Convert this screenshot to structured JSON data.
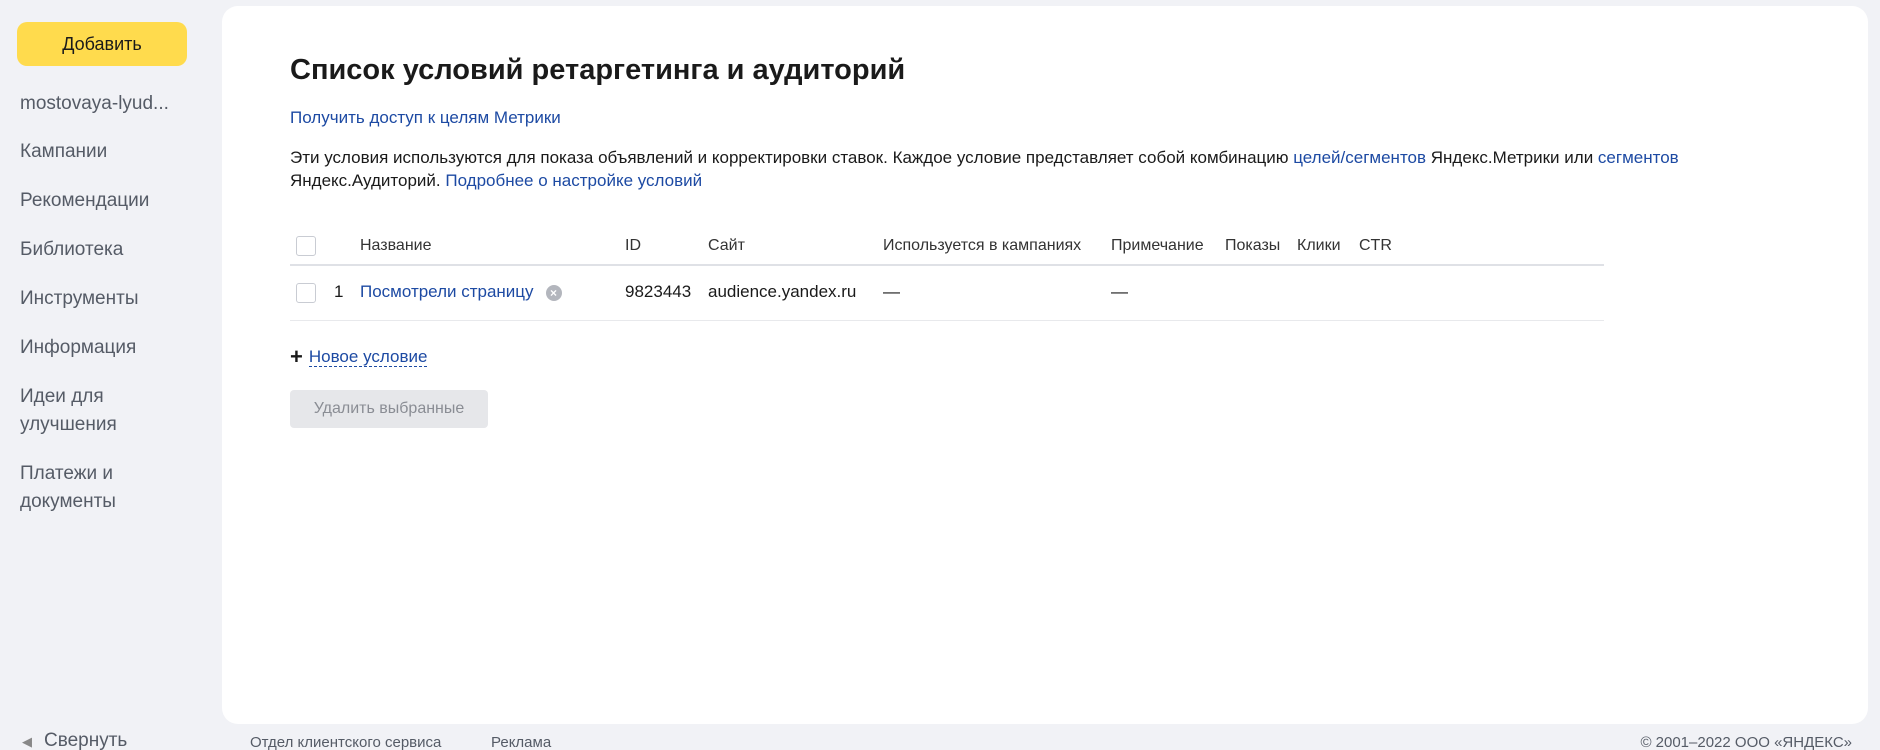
{
  "sidebar": {
    "add_label": "Добавить",
    "account": "mostovaya-lyud...",
    "items": [
      {
        "label": "Кампании"
      },
      {
        "label": "Рекомендации"
      },
      {
        "label": "Библиотека"
      },
      {
        "label": "Инструменты"
      },
      {
        "label": "Информация"
      },
      {
        "label": "Идеи для улучшения"
      },
      {
        "label": "Платежи и документы"
      }
    ],
    "collapse_label": "Свернуть"
  },
  "main": {
    "title": "Список условий ретаргетинга и аудиторий",
    "metrika_link": "Получить доступ к целям Метрики",
    "description": {
      "part1": "Эти условия используются для показа объявлений и корректировки ставок. Каждое условие представляет собой комбинацию ",
      "link1": "целей/сегментов",
      "part2": " Яндекс.Метрики или ",
      "link2": "сегментов",
      "part3": " Яндекс.Аудиторий. ",
      "link3": "Подробнее о настройке условий"
    },
    "table": {
      "headers": {
        "name": "Название",
        "id": "ID",
        "site": "Сайт",
        "used_in_campaigns": "Используется в кампаниях",
        "note": "Примечание",
        "impressions": "Показы",
        "clicks": "Клики",
        "ctr": "CTR"
      },
      "rows": [
        {
          "index": "1",
          "name": "Посмотрели страницу",
          "id": "9823443",
          "site": "audience.yandex.ru",
          "used_in_campaigns": "—",
          "note": "—",
          "impressions": "",
          "clicks": "",
          "ctr": ""
        }
      ]
    },
    "new_condition_label": "Новое условие",
    "delete_selected_label": "Удалить выбранные"
  },
  "footer": {
    "support_link": "Отдел клиентского сервиса",
    "ads_link": "Реклама",
    "copyright": "© 2001–2022 ООО «ЯНДЕКС»"
  },
  "colors": {
    "accent_yellow": "#ffdb4d",
    "link_blue": "#1d4aa3",
    "page_bg": "#f1f2f6"
  }
}
